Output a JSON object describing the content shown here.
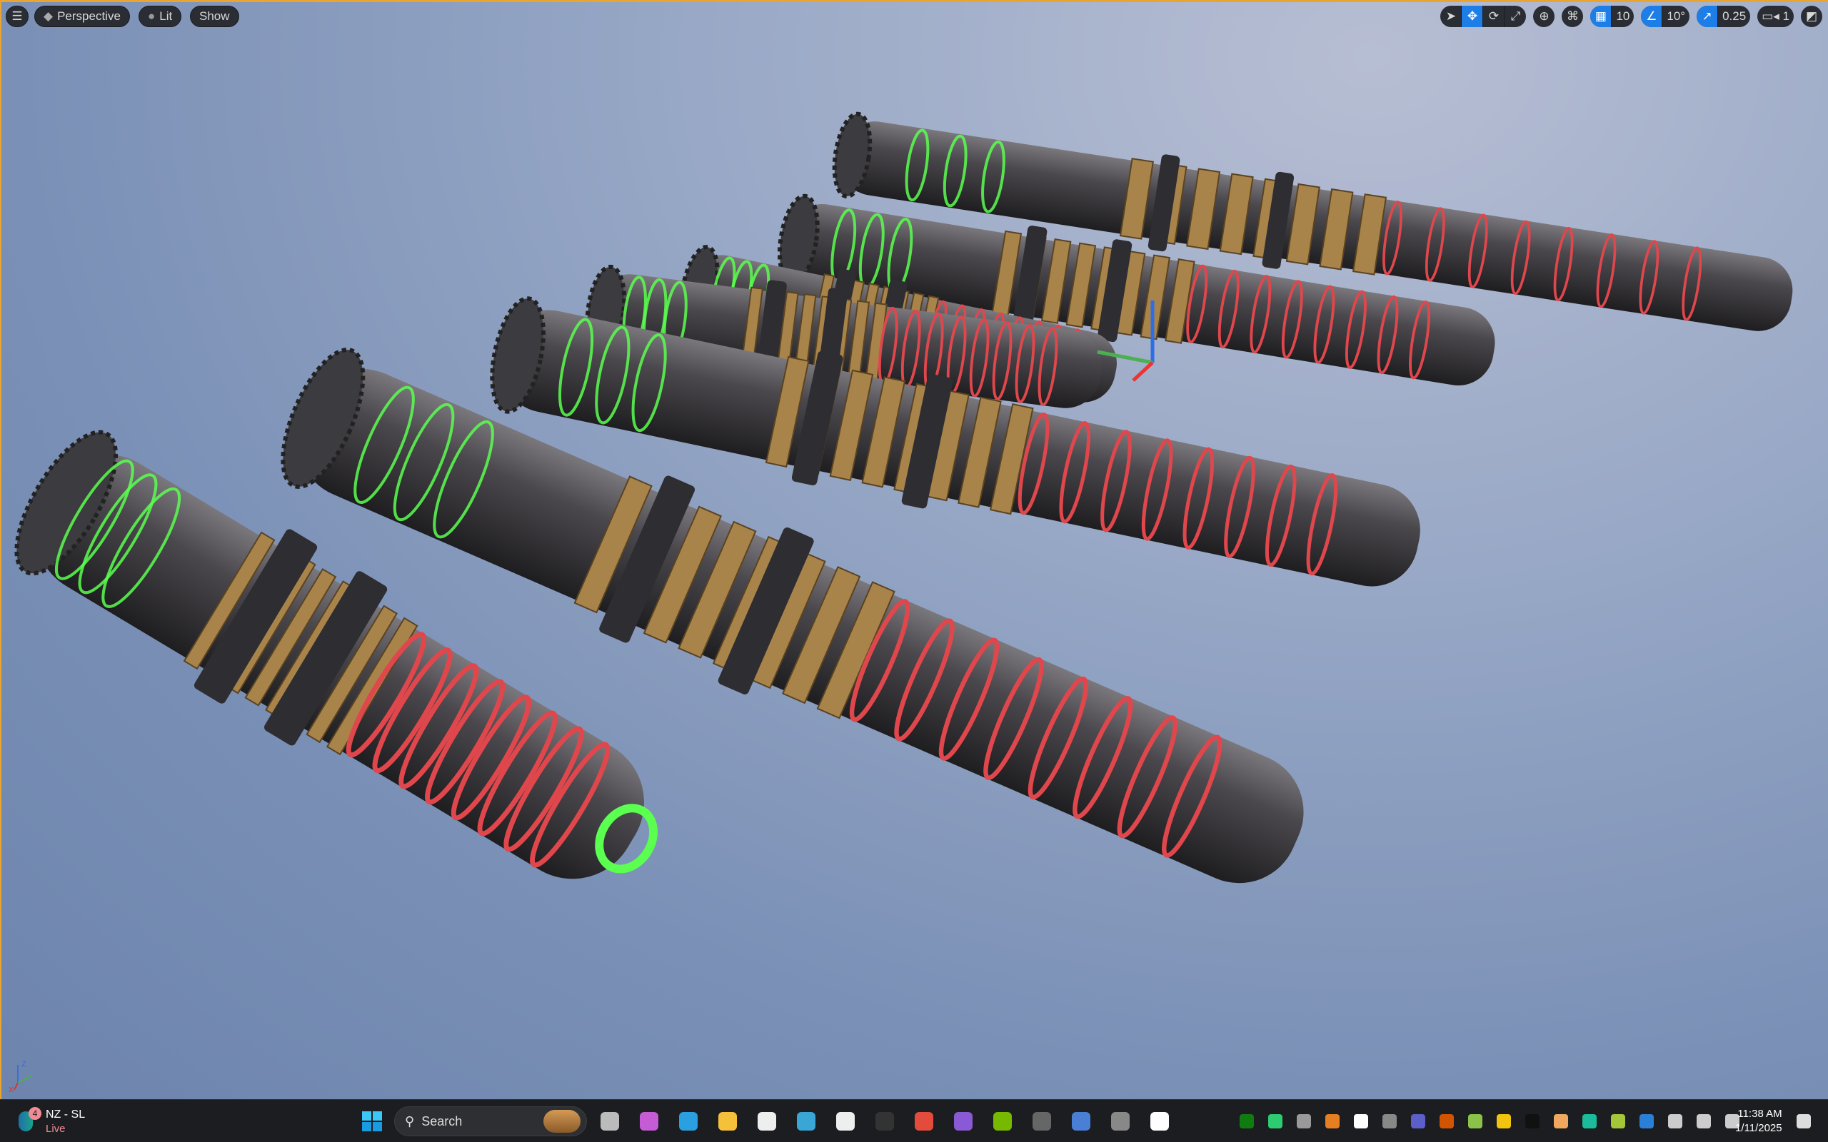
{
  "viewport": {
    "menu_icon": "hamburger-icon",
    "perspective_label": "Perspective",
    "lit_label": "Lit",
    "show_label": "Show",
    "grid_snap_value": "10",
    "rotation_snap_value": "10°",
    "scale_snap_value": "0.25",
    "camera_speed_value": "1",
    "axis_labels": {
      "z": "Z",
      "x": "X"
    }
  },
  "taskbar": {
    "widget_title": "NZ - SL",
    "widget_status": "Live",
    "widget_badge": "4",
    "search_placeholder": "Search",
    "time": "11:38 AM",
    "date": "1/11/2025"
  },
  "colors": {
    "accent": "#1e7ee8",
    "border": "#e9a530",
    "glow": "#55ff55",
    "stripe": "#e0474c",
    "gear": "#b8914e"
  }
}
